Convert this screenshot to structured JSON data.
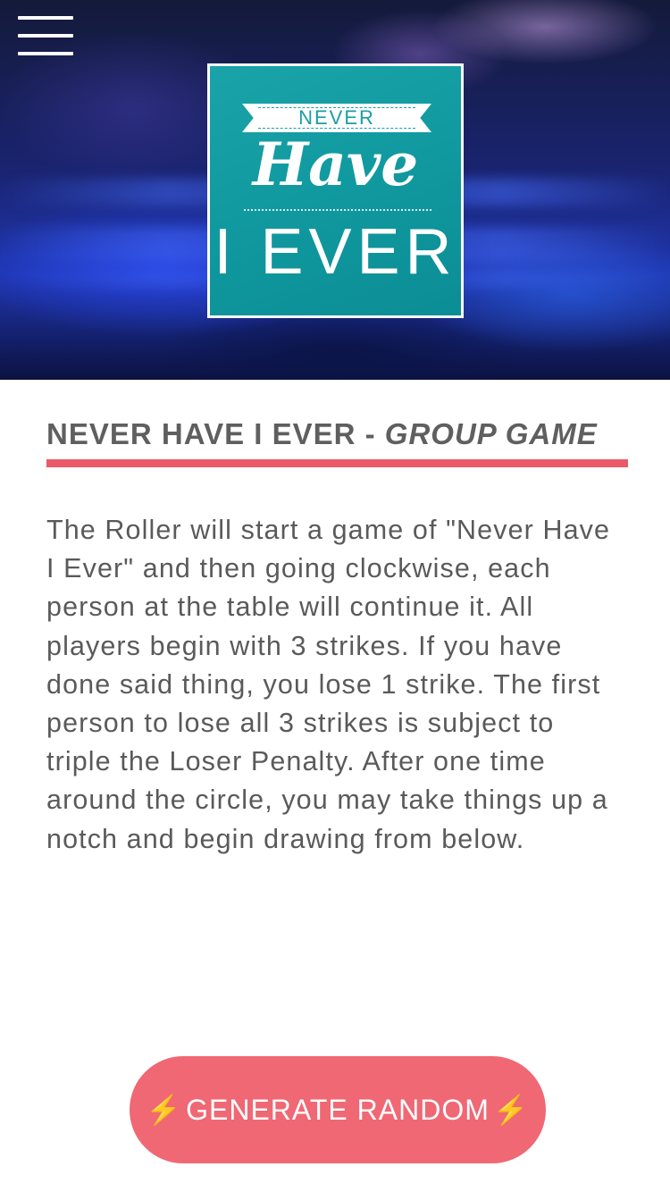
{
  "header": {
    "menu_icon": "hamburger-menu-icon",
    "logo": {
      "line1": "NEVER",
      "line2": "Have",
      "line3": "I EVER"
    }
  },
  "game": {
    "title": "NEVER HAVE I EVER - ",
    "subtitle": "GROUP GAME",
    "accent_color": "#ea5b69",
    "description": "The Roller will start a game of \"Never Have I Ever\" and then going clockwise, each person at the table will continue it. All players begin with 3 strikes. If you have done said thing, you lose 1 strike. The first person to lose all 3 strikes is subject to triple the Loser Penalty. After one time around the circle, you may take things up a notch and begin drawing from below."
  },
  "actions": {
    "generate_label": "GENERATE RANDOM",
    "bolt_icon": "lightning-bolt-icon",
    "bolt_glyph": "⚡",
    "button_color": "#ef6874"
  }
}
